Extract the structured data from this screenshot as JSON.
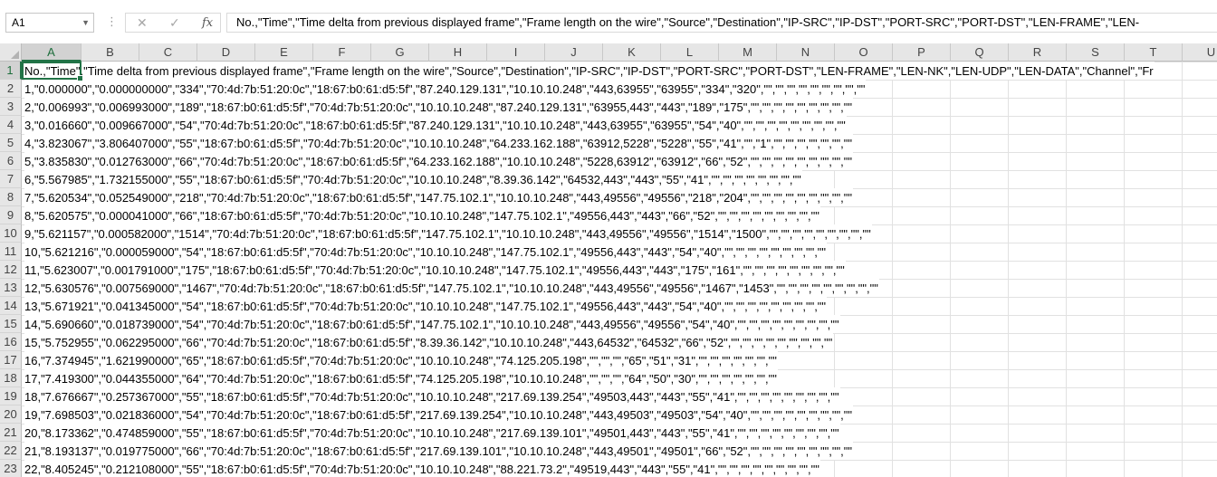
{
  "formula_bar": {
    "name_box": "A1",
    "separator": "⋮",
    "cancel_glyph": "✕",
    "enter_glyph": "✓",
    "insert_function_glyph": "fx",
    "formula": "No.,\"Time\",\"Time delta from previous displayed frame\",\"Frame length on the wire\",\"Source\",\"Destination\",\"IP-SRC\",\"IP-DST\",\"PORT-SRC\",\"PORT-DST\",\"LEN-FRAME\",\"LEN-"
  },
  "columns": [
    "A",
    "B",
    "C",
    "D",
    "E",
    "F",
    "G",
    "H",
    "I",
    "J",
    "K",
    "L",
    "M",
    "N",
    "O",
    "P",
    "Q",
    "R",
    "S",
    "T",
    "U"
  ],
  "rows": [
    {
      "num": "1",
      "text": "No.,\"Time\",\"Time delta from previous displayed frame\",\"Frame length on the wire\",\"Source\",\"Destination\",\"IP-SRC\",\"IP-DST\",\"PORT-SRC\",\"PORT-DST\",\"LEN-FRAME\",\"LEN-NK\",\"LEN-UDP\",\"LEN-DATA\",\"Channel\",\"Fr"
    },
    {
      "num": "2",
      "text": "1,\"0.000000\",\"0.000000000\",\"334\",\"70:4d:7b:51:20:0c\",\"18:67:b0:61:d5:5f\",\"87.240.129.131\",\"10.10.10.248\",\"443,63955\",\"63955\",\"334\",\"320\",\"\",\"\",\"\",\"\",\"\",\"\",\"\",\"\",\"\""
    },
    {
      "num": "3",
      "text": "2,\"0.006993\",\"0.006993000\",\"189\",\"18:67:b0:61:d5:5f\",\"70:4d:7b:51:20:0c\",\"10.10.10.248\",\"87.240.129.131\",\"63955,443\",\"443\",\"189\",\"175\",\"\",\"\",\"\",\"\",\"\",\"\",\"\",\"\",\"\""
    },
    {
      "num": "4",
      "text": "3,\"0.016660\",\"0.009667000\",\"54\",\"70:4d:7b:51:20:0c\",\"18:67:b0:61:d5:5f\",\"87.240.129.131\",\"10.10.10.248\",\"443,63955\",\"63955\",\"54\",\"40\",\"\",\"\",\"\",\"\",\"\",\"\",\"\",\"\",\"\""
    },
    {
      "num": "5",
      "text": "4,\"3.823067\",\"3.806407000\",\"55\",\"18:67:b0:61:d5:5f\",\"70:4d:7b:51:20:0c\",\"10.10.10.248\",\"64.233.162.188\",\"63912,5228\",\"5228\",\"55\",\"41\",\"\",\"1\",\"\",\"\",\"\",\"\",\"\",\"\",\"\""
    },
    {
      "num": "6",
      "text": "5,\"3.835830\",\"0.012763000\",\"66\",\"70:4d:7b:51:20:0c\",\"18:67:b0:61:d5:5f\",\"64.233.162.188\",\"10.10.10.248\",\"5228,63912\",\"63912\",\"66\",\"52\",\"\",\"\",\"\",\"\",\"\",\"\",\"\",\"\",\"\""
    },
    {
      "num": "7",
      "text": "6,\"5.567985\",\"1.732155000\",\"55\",\"18:67:b0:61:d5:5f\",\"70:4d:7b:51:20:0c\",\"10.10.10.248\",\"8.39.36.142\",\"64532,443\",\"443\",\"55\",\"41\",\"\",\"\",\"\",\"\",\"\",\"\",\"\",\"\""
    },
    {
      "num": "8",
      "text": "7,\"5.620534\",\"0.052549000\",\"218\",\"70:4d:7b:51:20:0c\",\"18:67:b0:61:d5:5f\",\"147.75.102.1\",\"10.10.10.248\",\"443,49556\",\"49556\",\"218\",\"204\",\"\",\"\",\"\",\"\",\"\",\"\",\"\",\"\",\"\""
    },
    {
      "num": "9",
      "text": "8,\"5.620575\",\"0.000041000\",\"66\",\"18:67:b0:61:d5:5f\",\"70:4d:7b:51:20:0c\",\"10.10.10.248\",\"147.75.102.1\",\"49556,443\",\"443\",\"66\",\"52\",\"\",\"\",\"\",\"\",\"\",\"\",\"\",\"\",\"\""
    },
    {
      "num": "10",
      "text": "9,\"5.621157\",\"0.000582000\",\"1514\",\"70:4d:7b:51:20:0c\",\"18:67:b0:61:d5:5f\",\"147.75.102.1\",\"10.10.10.248\",\"443,49556\",\"49556\",\"1514\",\"1500\",\"\",\"\",\"\",\"\",\"\",\"\",\"\",\"\",\"\""
    },
    {
      "num": "11",
      "text": "10,\"5.621216\",\"0.000059000\",\"54\",\"18:67:b0:61:d5:5f\",\"70:4d:7b:51:20:0c\",\"10.10.10.248\",\"147.75.102.1\",\"49556,443\",\"443\",\"54\",\"40\",\"\",\"\",\"\",\"\",\"\",\"\",\"\",\"\",\"\""
    },
    {
      "num": "12",
      "text": "11,\"5.623007\",\"0.001791000\",\"175\",\"18:67:b0:61:d5:5f\",\"70:4d:7b:51:20:0c\",\"10.10.10.248\",\"147.75.102.1\",\"49556,443\",\"443\",\"175\",\"161\",\"\",\"\",\"\",\"\",\"\",\"\",\"\",\"\",\"\""
    },
    {
      "num": "13",
      "text": "12,\"5.630576\",\"0.007569000\",\"1467\",\"70:4d:7b:51:20:0c\",\"18:67:b0:61:d5:5f\",\"147.75.102.1\",\"10.10.10.248\",\"443,49556\",\"49556\",\"1467\",\"1453\",\"\",\"\",\"\",\"\",\"\",\"\",\"\",\"\",\"\""
    },
    {
      "num": "14",
      "text": "13,\"5.671921\",\"0.041345000\",\"54\",\"18:67:b0:61:d5:5f\",\"70:4d:7b:51:20:0c\",\"10.10.10.248\",\"147.75.102.1\",\"49556,443\",\"443\",\"54\",\"40\",\"\",\"\",\"\",\"\",\"\",\"\",\"\",\"\",\"\""
    },
    {
      "num": "15",
      "text": "14,\"5.690660\",\"0.018739000\",\"54\",\"70:4d:7b:51:20:0c\",\"18:67:b0:61:d5:5f\",\"147.75.102.1\",\"10.10.10.248\",\"443,49556\",\"49556\",\"54\",\"40\",\"\",\"\",\"\",\"\",\"\",\"\",\"\",\"\",\"\""
    },
    {
      "num": "16",
      "text": "15,\"5.752955\",\"0.062295000\",\"66\",\"70:4d:7b:51:20:0c\",\"18:67:b0:61:d5:5f\",\"8.39.36.142\",\"10.10.10.248\",\"443,64532\",\"64532\",\"66\",\"52\",\"\",\"\",\"\",\"\",\"\",\"\",\"\",\"\",\"\""
    },
    {
      "num": "17",
      "text": "16,\"7.374945\",\"1.621990000\",\"65\",\"18:67:b0:61:d5:5f\",\"70:4d:7b:51:20:0c\",\"10.10.10.248\",\"74.125.205.198\",\"\",\"\",\"\",\"65\",\"51\",\"31\",\"\",\"\",\"\",\"\",\"\",\"\",\"\""
    },
    {
      "num": "18",
      "text": "17,\"7.419300\",\"0.044355000\",\"64\",\"70:4d:7b:51:20:0c\",\"18:67:b0:61:d5:5f\",\"74.125.205.198\",\"10.10.10.248\",\"\",\"\",\"\",\"64\",\"50\",\"30\",\"\",\"\",\"\",\"\",\"\",\"\",\"\""
    },
    {
      "num": "19",
      "text": "18,\"7.676667\",\"0.257367000\",\"55\",\"18:67:b0:61:d5:5f\",\"70:4d:7b:51:20:0c\",\"10.10.10.248\",\"217.69.139.254\",\"49503,443\",\"443\",\"55\",\"41\",\"\",\"\",\"\",\"\",\"\",\"\",\"\",\"\",\"\""
    },
    {
      "num": "20",
      "text": "19,\"7.698503\",\"0.021836000\",\"54\",\"70:4d:7b:51:20:0c\",\"18:67:b0:61:d5:5f\",\"217.69.139.254\",\"10.10.10.248\",\"443,49503\",\"49503\",\"54\",\"40\",\"\",\"\",\"\",\"\",\"\",\"\",\"\",\"\",\"\""
    },
    {
      "num": "21",
      "text": "20,\"8.173362\",\"0.474859000\",\"55\",\"18:67:b0:61:d5:5f\",\"70:4d:7b:51:20:0c\",\"10.10.10.248\",\"217.69.139.101\",\"49501,443\",\"443\",\"55\",\"41\",\"\",\"\",\"\",\"\",\"\",\"\",\"\",\"\",\"\""
    },
    {
      "num": "22",
      "text": "21,\"8.193137\",\"0.019775000\",\"66\",\"70:4d:7b:51:20:0c\",\"18:67:b0:61:d5:5f\",\"217.69.139.101\",\"10.10.10.248\",\"443,49501\",\"49501\",\"66\",\"52\",\"\",\"\",\"\",\"\",\"\",\"\",\"\",\"\",\"\""
    },
    {
      "num": "23",
      "text": "22,\"8.405245\",\"0.212108000\",\"55\",\"18:67:b0:61:d5:5f\",\"70:4d:7b:51:20:0c\",\"10.10.10.248\",\"88.221.73.2\",\"49519,443\",\"443\",\"55\",\"41\",\"\",\"\",\"\",\"\",\"\",\"\",\"\",\"\",\"\""
    }
  ]
}
